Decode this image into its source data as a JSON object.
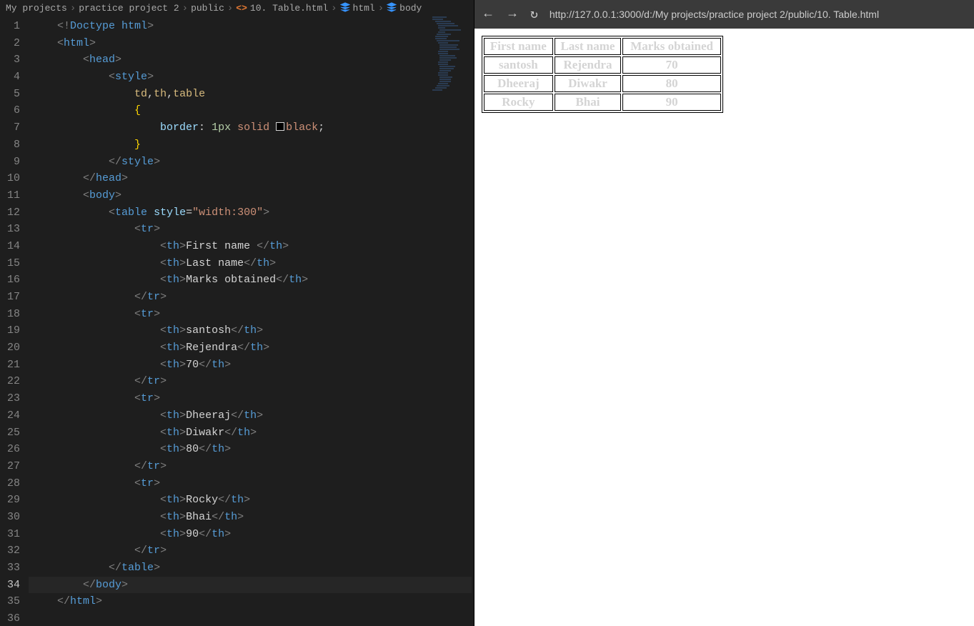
{
  "breadcrumbs": {
    "items": [
      "My projects",
      "practice project 2",
      "public",
      "10. Table.html",
      "html",
      "body"
    ]
  },
  "code": {
    "lines": [
      {
        "n": 1,
        "segs": [
          {
            "c": "c-punct",
            "t": "<!"
          },
          {
            "c": "c-doctype",
            "t": "Doctype "
          },
          {
            "c": "c-doctype",
            "t": "html"
          },
          {
            "c": "c-punct",
            "t": ">"
          }
        ],
        "ind": 1
      },
      {
        "n": 2,
        "segs": [
          {
            "c": "c-punct",
            "t": "<"
          },
          {
            "c": "c-tag",
            "t": "html"
          },
          {
            "c": "c-punct",
            "t": ">"
          }
        ],
        "ind": 1
      },
      {
        "n": 3,
        "segs": [
          {
            "c": "c-punct",
            "t": "<"
          },
          {
            "c": "c-tag",
            "t": "head"
          },
          {
            "c": "c-punct",
            "t": ">"
          }
        ],
        "ind": 2
      },
      {
        "n": 4,
        "segs": [
          {
            "c": "c-punct",
            "t": "<"
          },
          {
            "c": "c-tag",
            "t": "style"
          },
          {
            "c": "c-punct",
            "t": ">"
          }
        ],
        "ind": 3
      },
      {
        "n": 5,
        "segs": [
          {
            "c": "c-selector",
            "t": "td"
          },
          {
            "c": "c-text",
            "t": ","
          },
          {
            "c": "c-selector",
            "t": "th"
          },
          {
            "c": "c-text",
            "t": ","
          },
          {
            "c": "c-selector",
            "t": "table"
          }
        ],
        "ind": 4
      },
      {
        "n": 6,
        "segs": [
          {
            "c": "c-brace",
            "t": "{"
          }
        ],
        "ind": 4
      },
      {
        "n": 7,
        "segs": [
          {
            "c": "c-prop",
            "t": "border"
          },
          {
            "c": "c-text",
            "t": ": "
          },
          {
            "c": "c-num",
            "t": "1px "
          },
          {
            "c": "c-kwd",
            "t": "solid "
          },
          {
            "c": "",
            "t": "",
            "box": true
          },
          {
            "c": "c-color",
            "t": "black"
          },
          {
            "c": "c-text",
            "t": ";"
          }
        ],
        "ind": 5
      },
      {
        "n": 8,
        "segs": [
          {
            "c": "c-brace",
            "t": "}"
          }
        ],
        "ind": 4
      },
      {
        "n": 9,
        "segs": [
          {
            "c": "c-punct",
            "t": "</"
          },
          {
            "c": "c-tag",
            "t": "style"
          },
          {
            "c": "c-punct",
            "t": ">"
          }
        ],
        "ind": 3
      },
      {
        "n": 10,
        "segs": [
          {
            "c": "c-punct",
            "t": "</"
          },
          {
            "c": "c-tag",
            "t": "head"
          },
          {
            "c": "c-punct",
            "t": ">"
          }
        ],
        "ind": 2
      },
      {
        "n": 11,
        "segs": [
          {
            "c": "c-punct",
            "t": "<"
          },
          {
            "c": "c-tag",
            "t": "body"
          },
          {
            "c": "c-punct",
            "t": ">"
          }
        ],
        "ind": 2
      },
      {
        "n": 12,
        "segs": [
          {
            "c": "c-punct",
            "t": "<"
          },
          {
            "c": "c-tag",
            "t": "table "
          },
          {
            "c": "c-attrname",
            "t": "style"
          },
          {
            "c": "c-text",
            "t": "="
          },
          {
            "c": "c-attrval",
            "t": "\"width:300\""
          },
          {
            "c": "c-punct",
            "t": ">"
          }
        ],
        "ind": 3
      },
      {
        "n": 13,
        "segs": [
          {
            "c": "c-punct",
            "t": "<"
          },
          {
            "c": "c-tag",
            "t": "tr"
          },
          {
            "c": "c-punct",
            "t": ">"
          }
        ],
        "ind": 4
      },
      {
        "n": 14,
        "segs": [
          {
            "c": "c-punct",
            "t": "<"
          },
          {
            "c": "c-tag",
            "t": "th"
          },
          {
            "c": "c-punct",
            "t": ">"
          },
          {
            "c": "c-text",
            "t": "First name "
          },
          {
            "c": "c-punct",
            "t": "</"
          },
          {
            "c": "c-tag",
            "t": "th"
          },
          {
            "c": "c-punct",
            "t": ">"
          }
        ],
        "ind": 5
      },
      {
        "n": 15,
        "segs": [
          {
            "c": "c-punct",
            "t": "<"
          },
          {
            "c": "c-tag",
            "t": "th"
          },
          {
            "c": "c-punct",
            "t": ">"
          },
          {
            "c": "c-text",
            "t": "Last name"
          },
          {
            "c": "c-punct",
            "t": "</"
          },
          {
            "c": "c-tag",
            "t": "th"
          },
          {
            "c": "c-punct",
            "t": ">"
          }
        ],
        "ind": 5
      },
      {
        "n": 16,
        "segs": [
          {
            "c": "c-punct",
            "t": "<"
          },
          {
            "c": "c-tag",
            "t": "th"
          },
          {
            "c": "c-punct",
            "t": ">"
          },
          {
            "c": "c-text",
            "t": "Marks obtained"
          },
          {
            "c": "c-punct",
            "t": "</"
          },
          {
            "c": "c-tag",
            "t": "th"
          },
          {
            "c": "c-punct",
            "t": ">"
          }
        ],
        "ind": 5
      },
      {
        "n": 17,
        "segs": [
          {
            "c": "c-punct",
            "t": "</"
          },
          {
            "c": "c-tag",
            "t": "tr"
          },
          {
            "c": "c-punct",
            "t": ">"
          }
        ],
        "ind": 4
      },
      {
        "n": 18,
        "segs": [
          {
            "c": "c-punct",
            "t": "<"
          },
          {
            "c": "c-tag",
            "t": "tr"
          },
          {
            "c": "c-punct",
            "t": ">"
          }
        ],
        "ind": 4
      },
      {
        "n": 19,
        "segs": [
          {
            "c": "c-punct",
            "t": "<"
          },
          {
            "c": "c-tag",
            "t": "th"
          },
          {
            "c": "c-punct",
            "t": ">"
          },
          {
            "c": "c-text",
            "t": "santosh"
          },
          {
            "c": "c-punct",
            "t": "</"
          },
          {
            "c": "c-tag",
            "t": "th"
          },
          {
            "c": "c-punct",
            "t": ">"
          }
        ],
        "ind": 5
      },
      {
        "n": 20,
        "segs": [
          {
            "c": "c-punct",
            "t": "<"
          },
          {
            "c": "c-tag",
            "t": "th"
          },
          {
            "c": "c-punct",
            "t": ">"
          },
          {
            "c": "c-text",
            "t": "Rejendra"
          },
          {
            "c": "c-punct",
            "t": "</"
          },
          {
            "c": "c-tag",
            "t": "th"
          },
          {
            "c": "c-punct",
            "t": ">"
          }
        ],
        "ind": 5
      },
      {
        "n": 21,
        "segs": [
          {
            "c": "c-punct",
            "t": "<"
          },
          {
            "c": "c-tag",
            "t": "th"
          },
          {
            "c": "c-punct",
            "t": ">"
          },
          {
            "c": "c-text",
            "t": "70"
          },
          {
            "c": "c-punct",
            "t": "</"
          },
          {
            "c": "c-tag",
            "t": "th"
          },
          {
            "c": "c-punct",
            "t": ">"
          }
        ],
        "ind": 5
      },
      {
        "n": 22,
        "segs": [
          {
            "c": "c-punct",
            "t": "</"
          },
          {
            "c": "c-tag",
            "t": "tr"
          },
          {
            "c": "c-punct",
            "t": ">"
          }
        ],
        "ind": 4
      },
      {
        "n": 23,
        "segs": [
          {
            "c": "c-punct",
            "t": "<"
          },
          {
            "c": "c-tag",
            "t": "tr"
          },
          {
            "c": "c-punct",
            "t": ">"
          }
        ],
        "ind": 4
      },
      {
        "n": 24,
        "segs": [
          {
            "c": "c-punct",
            "t": "<"
          },
          {
            "c": "c-tag",
            "t": "th"
          },
          {
            "c": "c-punct",
            "t": ">"
          },
          {
            "c": "c-text",
            "t": "Dheeraj"
          },
          {
            "c": "c-punct",
            "t": "</"
          },
          {
            "c": "c-tag",
            "t": "th"
          },
          {
            "c": "c-punct",
            "t": ">"
          }
        ],
        "ind": 5
      },
      {
        "n": 25,
        "segs": [
          {
            "c": "c-punct",
            "t": "<"
          },
          {
            "c": "c-tag",
            "t": "th"
          },
          {
            "c": "c-punct",
            "t": ">"
          },
          {
            "c": "c-text",
            "t": "Diwakr"
          },
          {
            "c": "c-punct",
            "t": "</"
          },
          {
            "c": "c-tag",
            "t": "th"
          },
          {
            "c": "c-punct",
            "t": ">"
          }
        ],
        "ind": 5
      },
      {
        "n": 26,
        "segs": [
          {
            "c": "c-punct",
            "t": "<"
          },
          {
            "c": "c-tag",
            "t": "th"
          },
          {
            "c": "c-punct",
            "t": ">"
          },
          {
            "c": "c-text",
            "t": "80"
          },
          {
            "c": "c-punct",
            "t": "</"
          },
          {
            "c": "c-tag",
            "t": "th"
          },
          {
            "c": "c-punct",
            "t": ">"
          }
        ],
        "ind": 5
      },
      {
        "n": 27,
        "segs": [
          {
            "c": "c-punct",
            "t": "</"
          },
          {
            "c": "c-tag",
            "t": "tr"
          },
          {
            "c": "c-punct",
            "t": ">"
          }
        ],
        "ind": 4
      },
      {
        "n": 28,
        "segs": [
          {
            "c": "c-punct",
            "t": "<"
          },
          {
            "c": "c-tag",
            "t": "tr"
          },
          {
            "c": "c-punct",
            "t": ">"
          }
        ],
        "ind": 4
      },
      {
        "n": 29,
        "segs": [
          {
            "c": "c-punct",
            "t": "<"
          },
          {
            "c": "c-tag",
            "t": "th"
          },
          {
            "c": "c-punct",
            "t": ">"
          },
          {
            "c": "c-text",
            "t": "Rocky"
          },
          {
            "c": "c-punct",
            "t": "</"
          },
          {
            "c": "c-tag",
            "t": "th"
          },
          {
            "c": "c-punct",
            "t": ">"
          }
        ],
        "ind": 5
      },
      {
        "n": 30,
        "segs": [
          {
            "c": "c-punct",
            "t": "<"
          },
          {
            "c": "c-tag",
            "t": "th"
          },
          {
            "c": "c-punct",
            "t": ">"
          },
          {
            "c": "c-text",
            "t": "Bhai"
          },
          {
            "c": "c-punct",
            "t": "</"
          },
          {
            "c": "c-tag",
            "t": "th"
          },
          {
            "c": "c-punct",
            "t": ">"
          }
        ],
        "ind": 5
      },
      {
        "n": 31,
        "segs": [
          {
            "c": "c-punct",
            "t": "<"
          },
          {
            "c": "c-tag",
            "t": "th"
          },
          {
            "c": "c-punct",
            "t": ">"
          },
          {
            "c": "c-text",
            "t": "90"
          },
          {
            "c": "c-punct",
            "t": "</"
          },
          {
            "c": "c-tag",
            "t": "th"
          },
          {
            "c": "c-punct",
            "t": ">"
          }
        ],
        "ind": 5
      },
      {
        "n": 32,
        "segs": [
          {
            "c": "c-punct",
            "t": "</"
          },
          {
            "c": "c-tag",
            "t": "tr"
          },
          {
            "c": "c-punct",
            "t": ">"
          }
        ],
        "ind": 4
      },
      {
        "n": 33,
        "segs": [
          {
            "c": "c-punct",
            "t": "</"
          },
          {
            "c": "c-tag",
            "t": "table"
          },
          {
            "c": "c-punct",
            "t": ">"
          }
        ],
        "ind": 3
      },
      {
        "n": 34,
        "segs": [
          {
            "c": "c-punct",
            "t": "</"
          },
          {
            "c": "c-tag",
            "t": "body"
          },
          {
            "c": "c-punct",
            "t": ">"
          }
        ],
        "ind": 2,
        "active": true
      },
      {
        "n": 35,
        "segs": [
          {
            "c": "c-punct",
            "t": "</"
          },
          {
            "c": "c-tag",
            "t": "html"
          },
          {
            "c": "c-punct",
            "t": ">"
          }
        ],
        "ind": 1
      },
      {
        "n": 36,
        "segs": [],
        "ind": 0
      }
    ]
  },
  "preview": {
    "url": "http://127.0.0.1:3000/d:/My projects/practice project 2/public/10. Table.html",
    "table": {
      "headers": [
        "First name",
        "Last name",
        "Marks obtained"
      ],
      "rows": [
        [
          "santosh",
          "Rejendra",
          "70"
        ],
        [
          "Dheeraj",
          "Diwakr",
          "80"
        ],
        [
          "Rocky",
          "Bhai",
          "90"
        ]
      ]
    }
  }
}
